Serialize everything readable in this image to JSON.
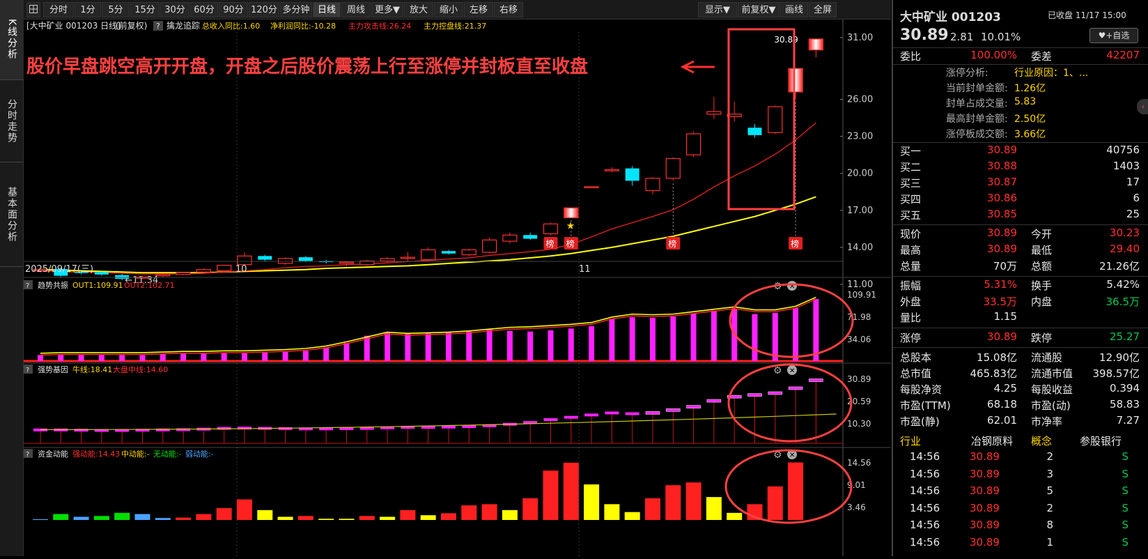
{
  "left_tabs": [
    {
      "label": "K线分析",
      "active": true
    },
    {
      "label": "分时走势",
      "active": false
    },
    {
      "label": "基本面分析",
      "active": false
    }
  ],
  "toolbar": {
    "menu_icon": "grid-menu-icon",
    "periods": [
      "分时",
      "1分",
      "5分",
      "15分",
      "30分",
      "60分",
      "90分",
      "120分",
      "多分钟",
      "日线",
      "周线",
      "更多▼",
      "放大",
      "缩小",
      "左移",
      "右移"
    ],
    "active": "日线",
    "right": [
      "显示▼",
      "前复权▼",
      "画线",
      "全屏"
    ]
  },
  "main": {
    "title": "[大中矿业 001203 日线]",
    "adj": "(前复权)",
    "help": "?",
    "indicator": "擒龙追踪",
    "metrics": [
      {
        "label": "总收入同比:1.60",
        "color": "#ffd600"
      },
      {
        "label": "净利润同比:-10.28",
        "color": "#ffd600"
      },
      {
        "label": "主力攻击线:26.24",
        "color": "#ff3030"
      },
      {
        "label": "主力控盘线:21.37",
        "color": "#ffd600"
      }
    ],
    "annotation": "股价早盘跳空高开开盘，开盘之后股价震荡上行至涨停并封板直至收盘",
    "last_price_label": "30.89",
    "low_label": "11.34",
    "date_labels": [
      "2025/09/17(三)",
      "10",
      "11"
    ],
    "bang_label": "榜",
    "star_icon": "star-icon",
    "y_labels": [
      "31.00",
      "26.00",
      "23.00",
      "20.00",
      "17.00",
      "14.00",
      "11.00"
    ]
  },
  "panel1": {
    "name": "趋势共振",
    "out1": "OUT1:109.91",
    "out2": "OUT2:102.71",
    "y_labels": [
      "109.91",
      "71.98",
      "34.06"
    ]
  },
  "panel2": {
    "name": "强势基因",
    "line1": "牛线:18.41",
    "line2": "大盘中线:14.60",
    "y_labels": [
      "30.89",
      "20.59",
      "10.30"
    ]
  },
  "panel3": {
    "name": "资金动能",
    "l1": "强动能:14.43",
    "l2": "中动能:-",
    "l3": "无动能:-",
    "l4": "弱动能:-",
    "y_labels": [
      "14.56",
      "9.01",
      "3.46"
    ]
  },
  "chart_data": {
    "type": "candlestick",
    "ylim": [
      11,
      31
    ],
    "candles": [
      [
        12.1,
        12.3,
        11.95,
        12.2
      ],
      [
        12.25,
        12.3,
        11.6,
        11.7
      ],
      [
        12.0,
        12.1,
        11.8,
        11.95
      ],
      [
        12.0,
        12.05,
        11.7,
        11.8
      ],
      [
        11.75,
        11.85,
        11.34,
        11.45
      ],
      [
        11.5,
        11.7,
        11.45,
        11.6
      ],
      [
        11.7,
        11.9,
        11.6,
        11.8
      ],
      [
        11.8,
        12.0,
        11.75,
        11.95
      ],
      [
        12.0,
        12.3,
        11.95,
        12.2
      ],
      [
        12.1,
        12.6,
        12.05,
        12.55
      ],
      [
        12.6,
        13.6,
        12.5,
        13.3
      ],
      [
        13.3,
        13.4,
        12.9,
        13.0
      ],
      [
        12.7,
        13.2,
        12.6,
        13.1
      ],
      [
        13.2,
        13.3,
        12.8,
        12.9
      ],
      [
        12.9,
        13.0,
        12.7,
        12.8
      ],
      [
        12.7,
        12.9,
        12.5,
        12.8
      ],
      [
        12.6,
        13.0,
        12.5,
        12.9
      ],
      [
        12.9,
        13.2,
        12.8,
        13.1
      ],
      [
        13.1,
        13.6,
        12.9,
        13.2
      ],
      [
        13.0,
        14.0,
        12.9,
        13.8
      ],
      [
        13.7,
        13.8,
        13.4,
        13.5
      ],
      [
        13.4,
        13.9,
        13.3,
        13.8
      ],
      [
        13.6,
        14.8,
        13.5,
        14.6
      ],
      [
        14.5,
        15.2,
        14.3,
        15.0
      ],
      [
        15.0,
        15.2,
        14.6,
        14.7
      ],
      [
        15.1,
        16.0,
        15.0,
        15.9
      ],
      [
        16.4,
        17.2,
        16.4,
        17.2
      ],
      [
        18.92,
        18.92,
        18.92,
        18.92
      ],
      [
        20.2,
        20.5,
        20.1,
        20.3
      ],
      [
        20.4,
        20.6,
        19.0,
        19.4
      ],
      [
        18.6,
        19.7,
        18.3,
        19.6
      ],
      [
        19.6,
        21.3,
        19.4,
        21.2
      ],
      [
        21.5,
        23.4,
        21.3,
        23.2
      ],
      [
        24.8,
        26.2,
        24.4,
        25.0
      ],
      [
        24.6,
        25.8,
        24.2,
        24.8
      ],
      [
        23.7,
        24.0,
        22.9,
        23.1
      ],
      [
        23.3,
        25.5,
        23.2,
        25.4
      ],
      [
        26.6,
        28.5,
        26.0,
        28.5
      ],
      [
        30.0,
        30.89,
        29.4,
        30.89
      ]
    ],
    "ma_red": [
      12.1,
      12.0,
      12.0,
      11.95,
      11.9,
      11.85,
      11.85,
      11.85,
      11.9,
      12.0,
      12.1,
      12.2,
      12.35,
      12.45,
      12.5,
      12.6,
      12.65,
      12.75,
      12.85,
      12.95,
      13.05,
      13.15,
      13.35,
      13.5,
      13.65,
      13.85,
      14.25,
      14.85,
      15.5,
      16.0,
      16.5,
      17.05,
      17.9,
      18.9,
      19.8,
      20.6,
      21.55,
      22.7,
      24.1
    ],
    "ma_yellow": [
      12.2,
      12.15,
      12.1,
      12.05,
      12.0,
      11.95,
      11.95,
      11.95,
      11.95,
      12.0,
      12.05,
      12.1,
      12.15,
      12.2,
      12.3,
      12.35,
      12.4,
      12.45,
      12.5,
      12.6,
      12.7,
      12.8,
      12.9,
      13.0,
      13.15,
      13.3,
      13.5,
      13.75,
      14.0,
      14.3,
      14.6,
      14.9,
      15.3,
      15.7,
      16.1,
      16.5,
      17.0,
      17.5,
      18.1
    ],
    "bang_idx": [
      25,
      26,
      31,
      37
    ],
    "ind1_bars": [
      3,
      2,
      2,
      2,
      2,
      2,
      2,
      3,
      4,
      5,
      6,
      8,
      10,
      10,
      10,
      10,
      10,
      10,
      12,
      12,
      12,
      13,
      13,
      14,
      15,
      17,
      22,
      30,
      42,
      48,
      45,
      46,
      48,
      49,
      53,
      50,
      49,
      51,
      54,
      58,
      70,
      73,
      72,
      74,
      79,
      84,
      86,
      78,
      80,
      88,
      103
    ],
    "ind1_line_y": [
      3,
      2,
      2,
      2,
      2,
      2,
      2,
      3,
      5,
      7,
      9,
      10,
      10,
      11,
      11,
      11,
      11,
      11,
      12,
      13,
      13,
      14,
      14,
      15,
      16,
      18,
      22,
      29,
      37,
      45,
      43,
      44,
      45,
      47,
      50,
      53,
      54,
      56,
      58,
      61,
      70,
      75,
      74,
      75,
      79,
      83,
      87,
      82,
      82,
      88,
      103
    ],
    "ind2_pink": [
      10.3,
      10.2,
      10.2,
      10.1,
      10.0,
      10.0,
      10.1,
      10.2,
      10.3,
      10.5,
      10.8,
      10.9,
      10.8,
      10.7,
      10.6,
      10.6,
      10.7,
      10.8,
      11.0,
      11.2,
      11.2,
      11.3,
      11.5,
      11.8,
      12.4,
      13.1,
      14.2,
      15.1,
      16.0,
      16.8,
      16.5,
      16.8,
      17.9,
      19.2,
      21.5,
      23.1,
      23.8,
      24.5,
      26.4,
      29.5
    ],
    "ind3_bars": [
      {
        "v": 0.2,
        "c": "#4ba3ff"
      },
      {
        "v": 1.5,
        "c": "#00e000"
      },
      {
        "v": 0.8,
        "c": "#4ba3ff"
      },
      {
        "v": 1.0,
        "c": "#00e000"
      },
      {
        "v": 1.8,
        "c": "#00e000"
      },
      {
        "v": 1.5,
        "c": "#4ba3ff"
      },
      {
        "v": 0.5,
        "c": "#4ba3ff"
      },
      {
        "v": 0.6,
        "c": "#ff2020"
      },
      {
        "v": 1.5,
        "c": "#ff2020"
      },
      {
        "v": 3.0,
        "c": "#ff2020"
      },
      {
        "v": 5.2,
        "c": "#ff2020"
      },
      {
        "v": 2.5,
        "c": "#ffff00"
      },
      {
        "v": 0.8,
        "c": "#ffff00"
      },
      {
        "v": 1.0,
        "c": "#ff2020"
      },
      {
        "v": 0.3,
        "c": "#ffff00"
      },
      {
        "v": 0.3,
        "c": "#ffff00"
      },
      {
        "v": 1.0,
        "c": "#ff2020"
      },
      {
        "v": 0.8,
        "c": "#ffff00"
      },
      {
        "v": 2.5,
        "c": "#ff2020"
      },
      {
        "v": 1.2,
        "c": "#ffff00"
      },
      {
        "v": 1.7,
        "c": "#ff2020"
      },
      {
        "v": 3.7,
        "c": "#ff2020"
      },
      {
        "v": 4.0,
        "c": "#ff2020"
      },
      {
        "v": 2.5,
        "c": "#ffff00"
      },
      {
        "v": 5.5,
        "c": "#ff2020"
      },
      {
        "v": 12.5,
        "c": "#ff2020"
      },
      {
        "v": 14.5,
        "c": "#ff2020"
      },
      {
        "v": 9.0,
        "c": "#ffff00"
      },
      {
        "v": 4.0,
        "c": "#ffff00"
      },
      {
        "v": 2.0,
        "c": "#ffff00"
      },
      {
        "v": 5.5,
        "c": "#ff2020"
      },
      {
        "v": 8.8,
        "c": "#ff2020"
      },
      {
        "v": 9.5,
        "c": "#ff2020"
      },
      {
        "v": 5.8,
        "c": "#ffff00"
      },
      {
        "v": 1.8,
        "c": "#ffff00"
      },
      {
        "v": 4.0,
        "c": "#ff2020"
      },
      {
        "v": 8.5,
        "c": "#ff2020"
      },
      {
        "v": 14.56,
        "c": "#ff2020"
      }
    ]
  },
  "quote": {
    "name": "大中矿业 001203",
    "status": "已收盘 11/17 15:00",
    "price": "30.89",
    "change": "2.81",
    "pct": "10.01%",
    "add_btn": "+自选",
    "heart_icon": "heart-icon",
    "weibi_l": "委比",
    "weibi_v": "100.00%",
    "weicha_l": "委差",
    "weicha_v": "42207",
    "limit_rows": [
      {
        "l": "涨停分析:",
        "v": "行业原因：1、..."
      },
      {
        "l": "当前封单金额:",
        "v": "1.26亿"
      },
      {
        "l": "封单占成交量:",
        "v": "5.83"
      },
      {
        "l": "最高封单金额:",
        "v": "2.50亿"
      },
      {
        "l": "涨停板成交额:",
        "v": "3.66亿"
      }
    ],
    "bids": [
      {
        "l": "买一",
        "p": "30.89",
        "v": "40756"
      },
      {
        "l": "买二",
        "p": "30.88",
        "v": "1403"
      },
      {
        "l": "买三",
        "p": "30.87",
        "v": "17"
      },
      {
        "l": "买四",
        "p": "30.86",
        "v": "6"
      },
      {
        "l": "买五",
        "p": "30.85",
        "v": "25"
      }
    ],
    "stats1": [
      {
        "l1": "现价",
        "v1": "30.89",
        "c1": "red",
        "l2": "今开",
        "v2": "30.23",
        "c2": "red"
      },
      {
        "l1": "最高",
        "v1": "30.89",
        "c1": "red",
        "l2": "最低",
        "v2": "29.40",
        "c2": "red"
      },
      {
        "l1": "总量",
        "v1": "70万",
        "c1": "white",
        "l2": "总额",
        "v2": "21.26亿",
        "c2": "white"
      }
    ],
    "stats2": [
      {
        "l1": "振幅",
        "v1": "5.31%",
        "c1": "red",
        "l2": "换手",
        "v2": "5.42%",
        "c2": "white"
      },
      {
        "l1": "外盘",
        "v1": "33.5万",
        "c1": "red",
        "l2": "内盘",
        "v2": "36.5万",
        "c2": "green"
      },
      {
        "l1": "量比",
        "v1": "1.15",
        "c1": "white",
        "l2": "",
        "v2": "",
        "c2": "white"
      }
    ],
    "stats3": [
      {
        "l1": "涨停",
        "v1": "30.89",
        "c1": "red",
        "l2": "跌停",
        "v2": "25.27",
        "c2": "green"
      }
    ],
    "stats4": [
      {
        "l1": "总股本",
        "v1": "15.08亿",
        "l2": "流通股",
        "v2": "12.90亿"
      },
      {
        "l1": "总市值",
        "v1": "465.83亿",
        "l2": "流通市值",
        "v2": "398.57亿"
      },
      {
        "l1": "每股净资",
        "v1": "4.25",
        "l2": "每股收益",
        "v2": "0.394"
      },
      {
        "l1": "市盈(TTM)",
        "v1": "68.18",
        "l2": "市盈(动)",
        "v2": "58.83"
      },
      {
        "l1": "市盈(静)",
        "v1": "62.01",
        "l2": "市净率",
        "v2": "7.27"
      }
    ],
    "industry": {
      "l": "行业",
      "v": "冶钢原料",
      "l2": "概念",
      "v2": "参股银行"
    },
    "ticks": [
      {
        "t": "14:56",
        "p": "30.89",
        "v": "2",
        "s": "S"
      },
      {
        "t": "14:56",
        "p": "30.89",
        "v": "3",
        "s": "S"
      },
      {
        "t": "14:56",
        "p": "30.89",
        "v": "5",
        "s": "S"
      },
      {
        "t": "14:56",
        "p": "30.89",
        "v": "2",
        "s": "S"
      },
      {
        "t": "14:56",
        "p": "30.89",
        "v": "8",
        "s": "S"
      },
      {
        "t": "14:56",
        "p": "30.89",
        "v": "1",
        "s": "S"
      }
    ]
  }
}
